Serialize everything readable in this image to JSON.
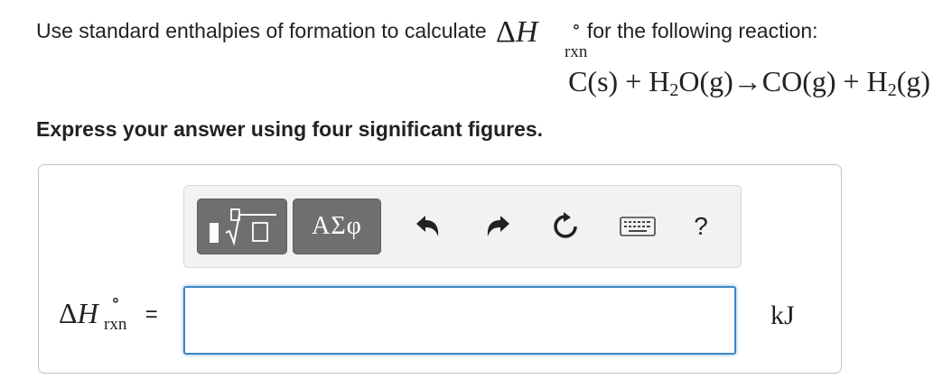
{
  "question": {
    "prefix": "Use standard enthalpies of formation to calculate",
    "symbol": {
      "delta": "Δ",
      "H": "H",
      "deg": "∘",
      "sub": "rxn"
    },
    "suffix": "for the following reaction:"
  },
  "equation": {
    "reactant1": "C(s)",
    "plus1": "+",
    "reactant2_H": "H",
    "reactant2_sub": "2",
    "reactant2_rest": "O(g)",
    "arrow": "→",
    "product1": "CO(g)",
    "plus2": "+",
    "product2_H": "H",
    "product2_sub": "2",
    "product2_rest": "(g)"
  },
  "instruction": "Express your answer using four significant figures.",
  "toolbar": {
    "greek_label": "ΑΣφ",
    "help_label": "?"
  },
  "answer": {
    "label": {
      "delta": "Δ",
      "H": "H",
      "deg": "∘",
      "sub": "rxn",
      "equals": "="
    },
    "value": "",
    "unit": "kJ"
  },
  "colors": {
    "toolbar_button": "#6f6f6f",
    "input_border": "#3d86c6",
    "box_border": "#c2c2c2"
  },
  "icons": [
    "templates-icon",
    "greek-letters-button",
    "undo-icon",
    "redo-icon",
    "reset-icon",
    "keyboard-icon",
    "help-icon"
  ]
}
